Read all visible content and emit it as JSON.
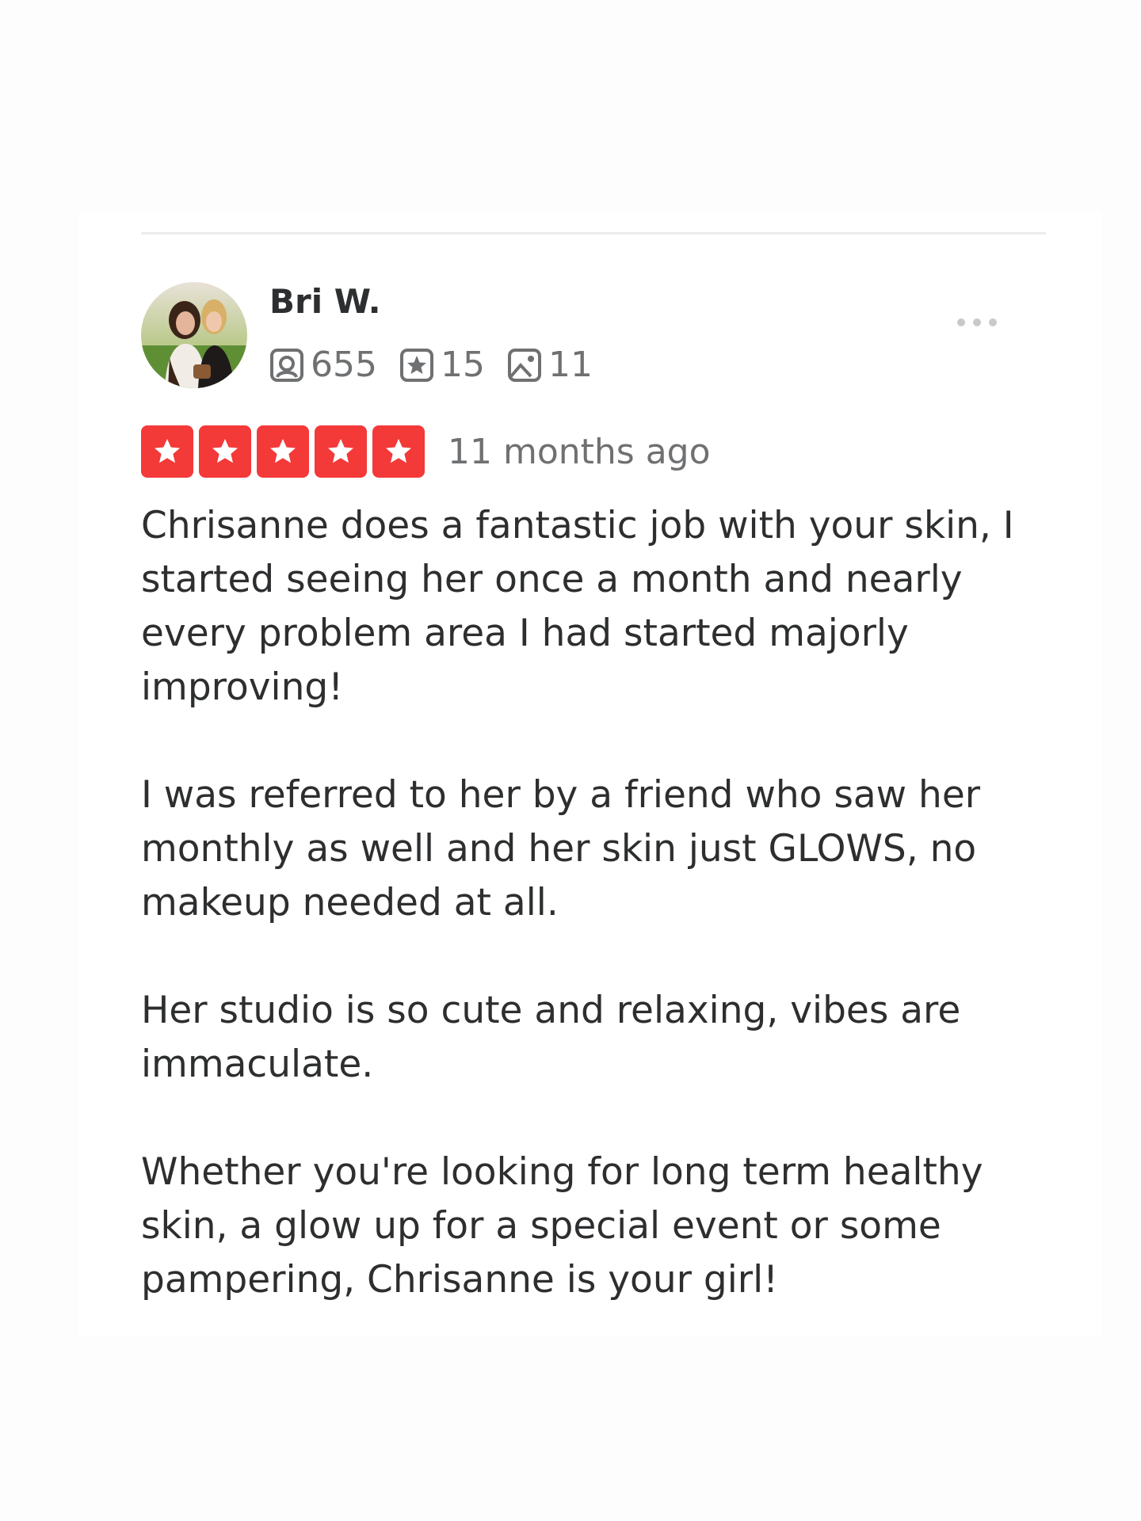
{
  "review": {
    "author": "Bri W.",
    "stats": {
      "reviews": "655",
      "elite": "15",
      "photos": "11"
    },
    "rating": 5,
    "rating_max": 5,
    "time": "11 months ago",
    "paragraphs": [
      "Chrisanne does a fantastic job with your skin, I started seeing her once a month and nearly every problem area I had started majorly improving!",
      "I was referred to her by a friend who saw her monthly as well and her skin just GLOWS, no makeup needed at all.",
      "Her studio is so cute and relaxing, vibes are immaculate.",
      "Whether you're looking for long term healthy skin, a glow up for a special event or some pampering, Chrisanne is your girl!"
    ]
  },
  "icons": {
    "reviews": "review-count-icon",
    "elite": "star-badge-icon",
    "photos": "photo-icon",
    "more": "more-options-icon",
    "star": "star-icon"
  },
  "colors": {
    "star_red": "#f43939",
    "text": "#2d2e2f",
    "muted": "#6e7072"
  }
}
